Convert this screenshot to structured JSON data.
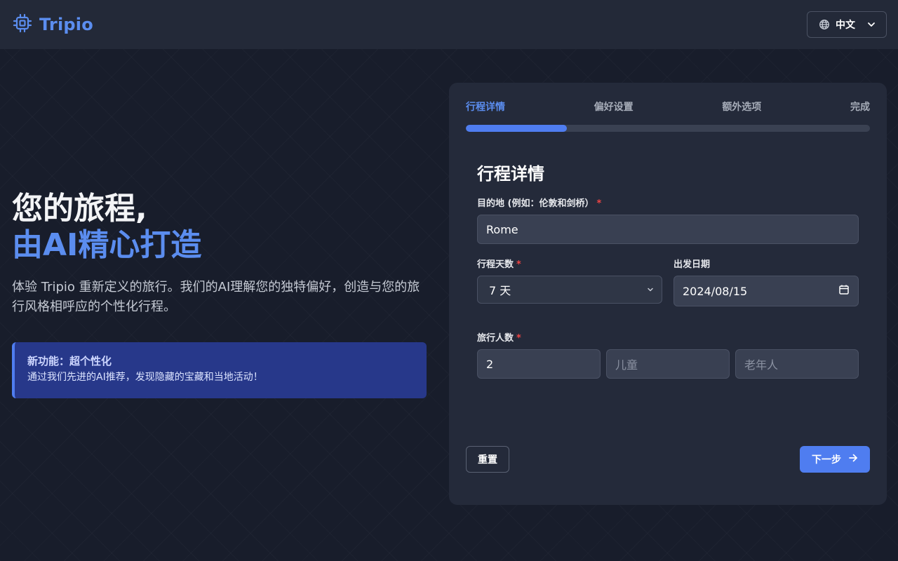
{
  "header": {
    "brand": "Tripio",
    "language": "中文"
  },
  "hero": {
    "line1": "您的旅程,",
    "line2": "由AI精心打造",
    "description": "体验 Tripio 重新定义的旅行。我们的AI理解您的独特偏好，创造与您的旅行风格相呼应的个性化行程。",
    "feature_title": "新功能：超个性化",
    "feature_text": "通过我们先进的AI推荐，发现隐藏的宝藏和当地活动！"
  },
  "steps": [
    {
      "label": "行程详情",
      "active": true
    },
    {
      "label": "偏好设置",
      "active": false
    },
    {
      "label": "额外选项",
      "active": false
    },
    {
      "label": "完成",
      "active": false
    }
  ],
  "progress": 0.25,
  "form": {
    "title": "行程详情",
    "destination_label": "目的地 (例如：伦敦和剑桥）",
    "destination_value": "Rome",
    "days_label": "行程天数",
    "days_value": "7 天",
    "date_label": "出发日期",
    "date_value": "2024/08/15",
    "travelers_label": "旅行人数",
    "adults_value": "2",
    "children_placeholder": "儿童",
    "seniors_placeholder": "老年人",
    "required_mark": "*"
  },
  "buttons": {
    "reset": "重置",
    "next": "下一步"
  },
  "colors": {
    "accent": "#5b8def",
    "primary_button": "#4f7df0",
    "feature_bg": "#27388a",
    "required": "#ef4444"
  },
  "icons": {
    "brand": "cpu-chip-icon",
    "language": "globe-icon",
    "dropdown": "chevron-down-icon",
    "calendar": "calendar-icon",
    "next": "arrow-right-icon"
  }
}
